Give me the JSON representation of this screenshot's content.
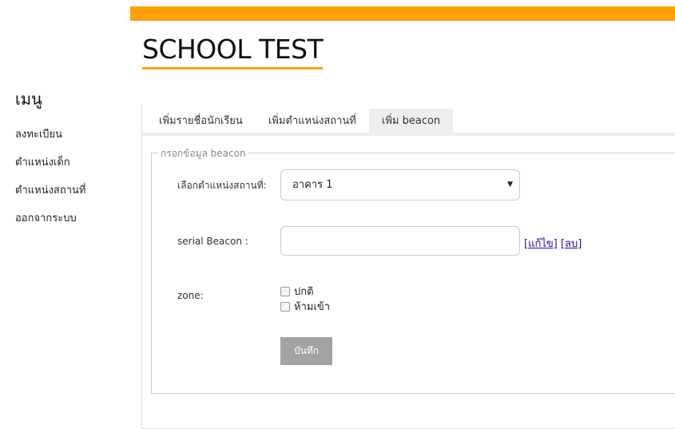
{
  "header": {
    "title": "SCHOOL TEST",
    "accent_color": "#ff9f00"
  },
  "sidebar": {
    "heading": "เมนู",
    "items": [
      {
        "label": "ลงทะเบียน"
      },
      {
        "label": "ตำแหน่งเด็ก"
      },
      {
        "label": "ตำแหน่งสถานที่"
      },
      {
        "label": "ออกจากระบบ"
      }
    ]
  },
  "tabs": [
    {
      "label": "เพิ่มรายชื่อนักเรียน",
      "active": false
    },
    {
      "label": "เพิ่มตำแหน่งสถานที่",
      "active": false
    },
    {
      "label": "เพิ่ม beacon",
      "active": true
    }
  ],
  "form": {
    "legend": "กรอกข้อมูล beacon",
    "location_label": "เลือกตำแหน่งสถานที่:",
    "location_value": "อาคาร 1",
    "serial_label": "serial Beacon :",
    "serial_value": "",
    "edit_link": "[แก้ไข]",
    "delete_link": "[ลบ]",
    "zone_label": "zone:",
    "zone_options": [
      {
        "label": "ปกติ",
        "checked": false
      },
      {
        "label": "ห้ามเข้า",
        "checked": false
      }
    ],
    "save_label": "บันทึก"
  }
}
